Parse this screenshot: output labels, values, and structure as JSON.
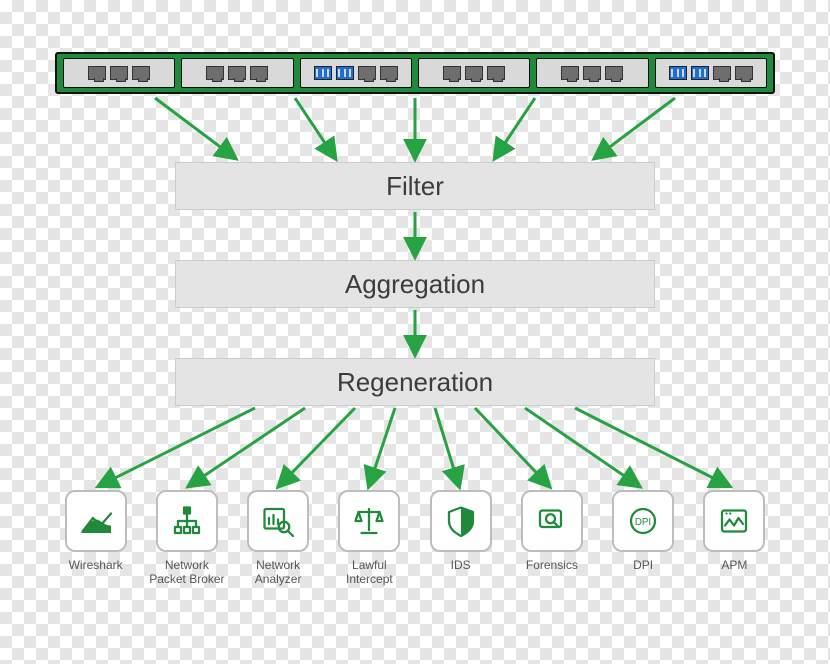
{
  "stages": {
    "filter": "Filter",
    "aggregation": "Aggregation",
    "regeneration": "Regeneration"
  },
  "appliance": {
    "modules": [
      {
        "ports": [
          "rj",
          "rj",
          "rj"
        ]
      },
      {
        "ports": [
          "rj",
          "rj",
          "rj"
        ]
      },
      {
        "ports": [
          "term",
          "term",
          "rj",
          "rj"
        ]
      },
      {
        "ports": [
          "rj",
          "rj",
          "rj"
        ]
      },
      {
        "ports": [
          "rj",
          "rj",
          "rj"
        ]
      },
      {
        "ports": [
          "term",
          "term",
          "rj",
          "rj"
        ]
      }
    ]
  },
  "tools": [
    {
      "icon": "wireshark",
      "label": "Wireshark"
    },
    {
      "icon": "npb",
      "label": "Network\nPacket Broker"
    },
    {
      "icon": "analyzer",
      "label": "Network\nAnalyzer"
    },
    {
      "icon": "lawful",
      "label": "Lawful\nIntercept"
    },
    {
      "icon": "ids",
      "label": "IDS"
    },
    {
      "icon": "forensics",
      "label": "Forensics"
    },
    {
      "icon": "dpi",
      "label": "DPI"
    },
    {
      "icon": "apm",
      "label": "APM"
    }
  ],
  "colors": {
    "accent": "#1f8a3b",
    "arrow": "#27a344",
    "box": "#e4e4e4"
  }
}
